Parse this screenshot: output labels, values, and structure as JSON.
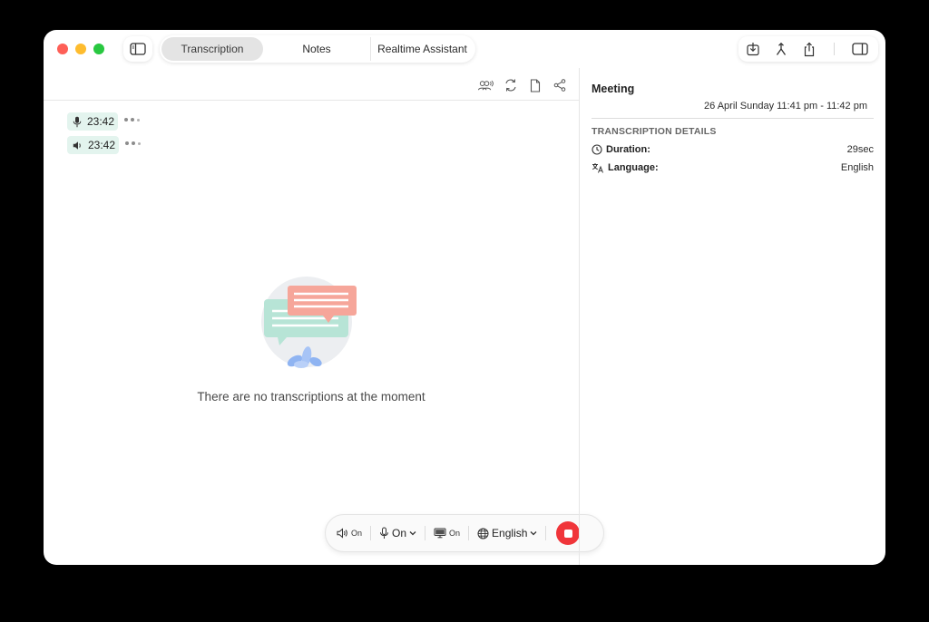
{
  "window": {
    "tabs": [
      {
        "label": "Transcription",
        "active": true
      },
      {
        "label": "Notes",
        "active": false
      },
      {
        "label": "Realtime Assistant",
        "active": false
      }
    ],
    "toolbar_icons": [
      "download-icon",
      "merge-icon",
      "share-icon",
      "right-sidebar-icon"
    ]
  },
  "transcript": {
    "segments": [
      {
        "source_icon": "microphone-icon",
        "time": "23:42"
      },
      {
        "source_icon": "speaker-icon",
        "time": "23:42"
      }
    ],
    "empty_message": "There are no transcriptions at the moment"
  },
  "controls": {
    "speaker_label": "On",
    "mic_label": "On",
    "screen_label": "On",
    "language_label": "English"
  },
  "details": {
    "title": "Meeting",
    "date": "26 April Sunday 11:41 pm - 11:42 pm",
    "section_header": "TRANSCRIPTION DETAILS",
    "duration_label": "Duration:",
    "duration_value": "29sec",
    "language_label": "Language:",
    "language_value": "English"
  },
  "colors": {
    "accent_red": "#f0353a",
    "chip_green": "#e3f4ee",
    "traffic_red": "#fe5f57",
    "traffic_yellow": "#febc2e",
    "traffic_green": "#28c840"
  }
}
